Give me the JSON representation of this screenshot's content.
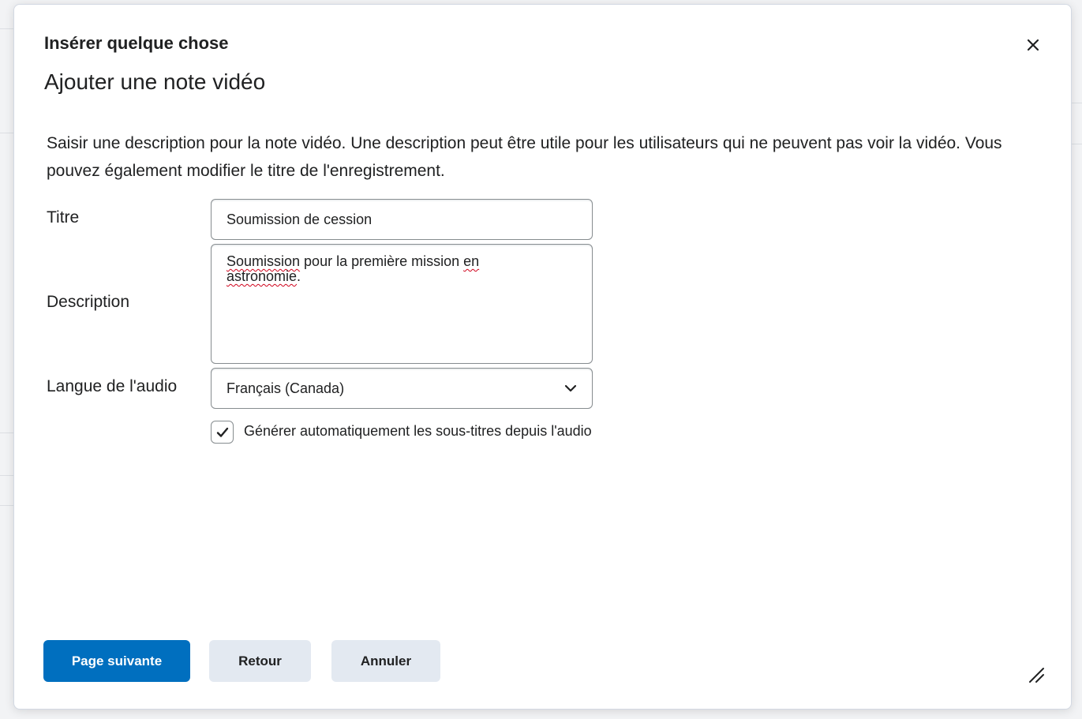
{
  "dialog": {
    "title": "Insérer quelque chose",
    "subtitle": "Ajouter une note vidéo",
    "close_icon": "close-icon",
    "intro": "Saisir une description pour la note vidéo. Une description peut être utile pour les utilisateurs qui ne peuvent pas voir la vidéo. Vous pouvez également modifier le titre de l'enregistrement."
  },
  "form": {
    "title_label": "Titre",
    "title_value": "Soumission de cession",
    "description_label": "Description",
    "description_words": [
      "Soumission",
      " pour la première mission ",
      "en",
      " ",
      "astronomie",
      "."
    ],
    "language_label": "Langue de l'audio",
    "language_value": "Français (Canada)",
    "language_icon": "chevron-down-icon",
    "captions_checked": true,
    "captions_label": "Générer automatiquement les sous-titres depuis l'audio"
  },
  "buttons": {
    "next": "Page suivante",
    "back": "Retour",
    "cancel": "Annuler"
  },
  "colors": {
    "primary": "#006fbf",
    "secondary": "#e3e9f1",
    "spellcheck": "#d0021b"
  }
}
